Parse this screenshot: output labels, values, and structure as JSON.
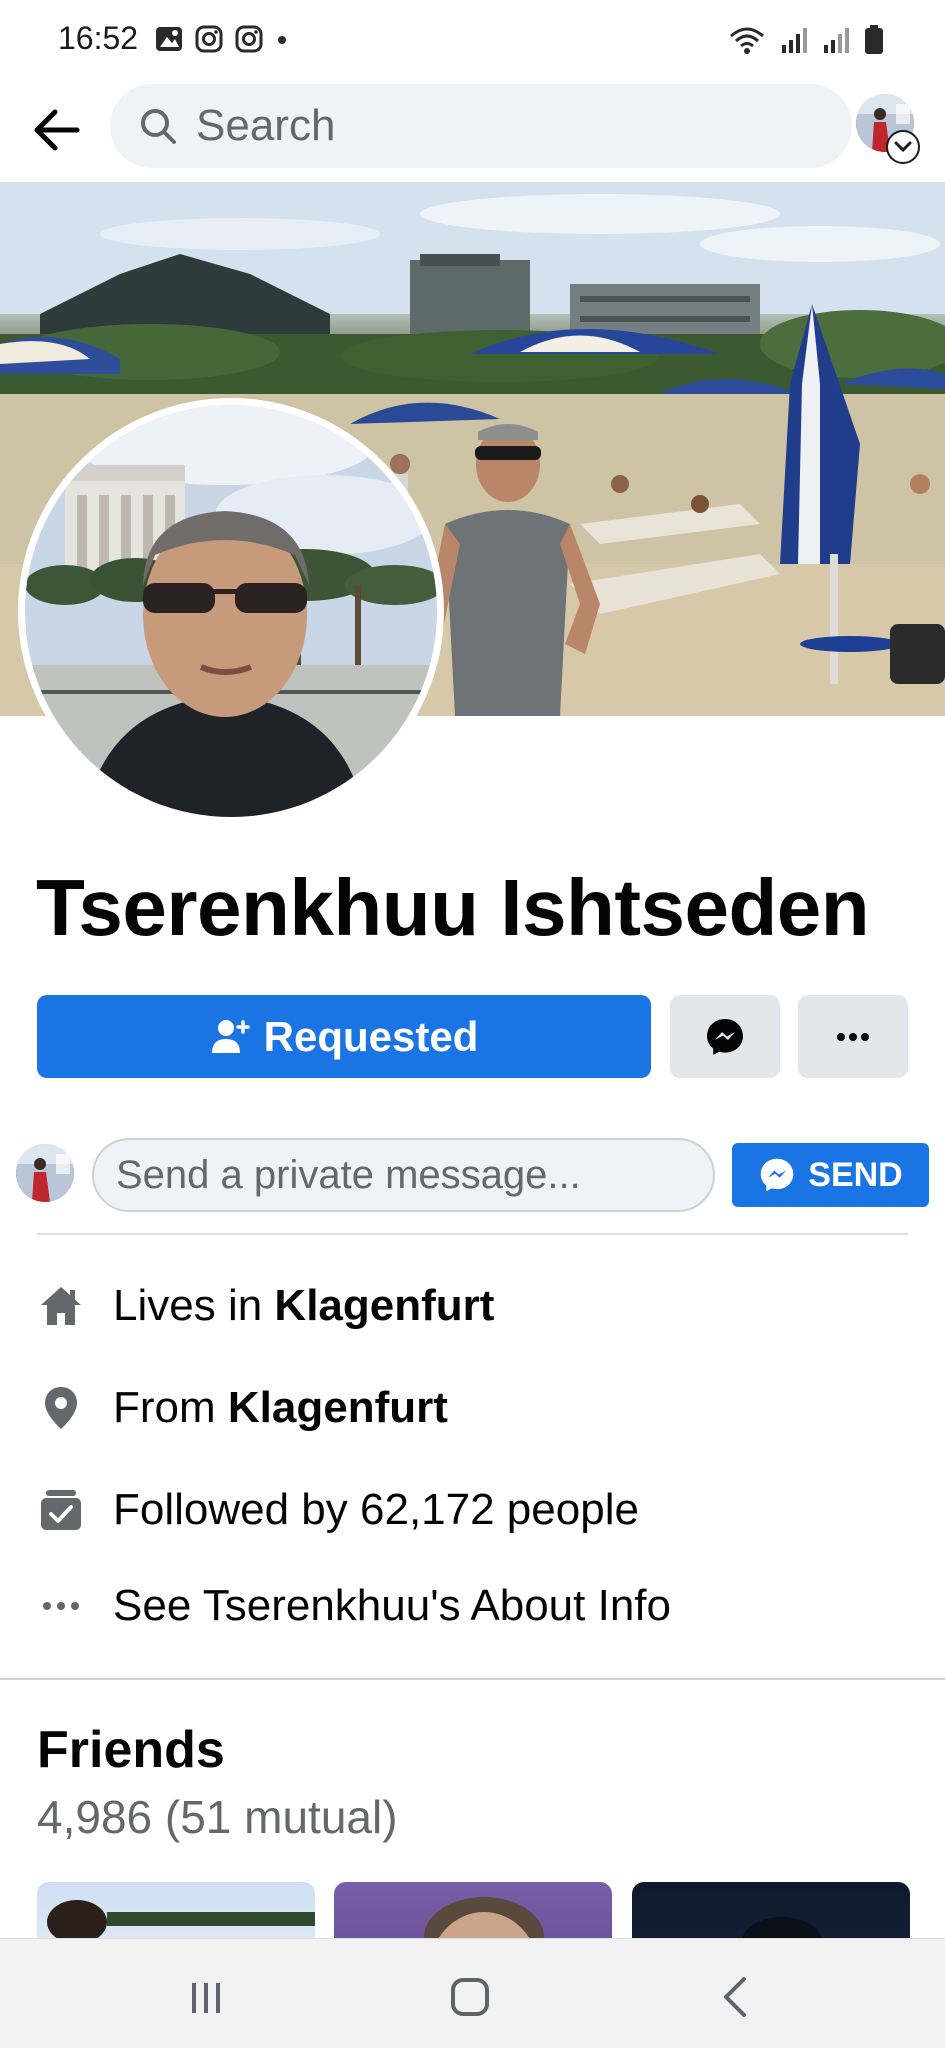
{
  "status_bar": {
    "time": "16:52"
  },
  "header": {
    "search_placeholder": "Search"
  },
  "profile": {
    "name": "Tserenkhuu Ishtseden"
  },
  "actions": {
    "requested_label": "Requested"
  },
  "private_message": {
    "placeholder": "Send a private message...",
    "send_label": "SEND"
  },
  "details": {
    "lives_in_prefix": "Lives in ",
    "lives_in_place": "Klagenfurt",
    "from_prefix": "From ",
    "from_place": "Klagenfurt",
    "followed_by": "Followed by 62,172 people",
    "about_info": "See Tserenkhuu's About Info"
  },
  "friends": {
    "title": "Friends",
    "count": "4,986 (51 mutual)"
  },
  "colors": {
    "primary_blue": "#1b74e4",
    "secondary_button": "#e4e6eb",
    "muted_text": "#65676b"
  },
  "icons": {
    "back": "arrow-left-icon",
    "search": "search-icon",
    "messenger": "messenger-icon",
    "more": "more-dots-icon",
    "home": "home-icon",
    "location": "location-pin-icon",
    "followers": "followers-icon",
    "about": "more-dots-icon"
  }
}
